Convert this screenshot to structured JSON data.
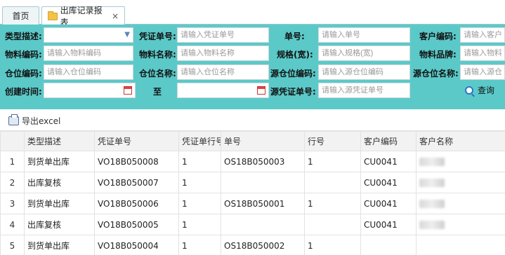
{
  "tabs": {
    "home": "首页",
    "report": "出库记录报表",
    "report_close": "×"
  },
  "filters": {
    "type_desc_label": "类型描述:",
    "type_desc_value": "",
    "voucher_no_label": "凭证单号:",
    "voucher_no_ph": "请输入凭证单号",
    "order_no_label": "单号:",
    "order_no_ph": "请输入单号",
    "customer_code_label": "客户编码:",
    "customer_code_ph": "请输入客户编",
    "material_code_label": "物料编码:",
    "material_code_ph": "请输入物料编码",
    "material_name_label": "物料名称:",
    "material_name_ph": "请输入物料名称",
    "spec_label": "规格(宽):",
    "spec_ph": "请输入规格(宽)",
    "material_brand_label": "物料品牌:",
    "material_brand_ph": "请输入物料品",
    "location_code_label": "仓位编码:",
    "location_code_ph": "请输入仓位编码",
    "location_name_label": "仓位名称:",
    "location_name_ph": "请输入仓位名称",
    "src_location_code_label": "源仓位编码:",
    "src_location_code_ph": "请输入源仓位编码",
    "src_location_name_label": "源仓位名称:",
    "src_location_name_ph": "请输入源仓",
    "created_time_label": "创建时间:",
    "to_label": "至",
    "src_voucher_label": "源凭证单号:",
    "src_voucher_ph": "请输入源凭证单号",
    "search_label": "查询"
  },
  "toolbar": {
    "export_label": "导出excel"
  },
  "grid": {
    "columns": [
      "",
      "类型描述",
      "凭证单号",
      "凭证单行号",
      "单号",
      "行号",
      "客户编码",
      "客户名称"
    ],
    "rows": [
      [
        "1",
        "到货单出库",
        "VO18B050008",
        "1",
        "OS18B050003",
        "1",
        "CU0041",
        ""
      ],
      [
        "2",
        "出库复核",
        "VO18B050007",
        "1",
        "",
        "",
        "CU0041",
        ""
      ],
      [
        "3",
        "到货单出库",
        "VO18B050006",
        "1",
        "OS18B050001",
        "1",
        "CU0041",
        ""
      ],
      [
        "4",
        "出库复核",
        "VO18B050005",
        "1",
        "",
        "",
        "CU0041",
        ""
      ],
      [
        "5",
        "到货单出库",
        "VO18B050004",
        "1",
        "OS18B050002",
        "1",
        "",
        ""
      ]
    ]
  },
  "colors": {
    "filter_bg": "#5cc9c9",
    "header_bg": "#f2f2f2"
  }
}
